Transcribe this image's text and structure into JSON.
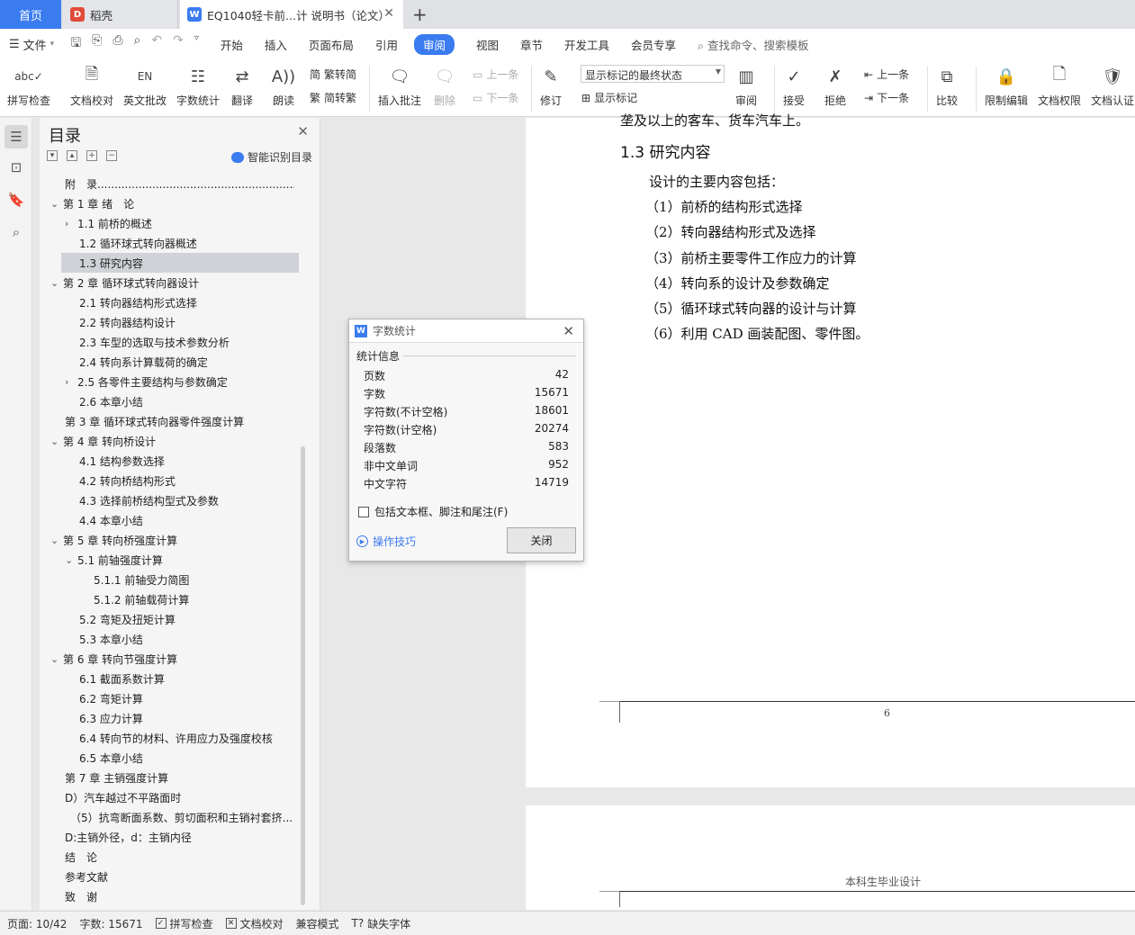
{
  "tabs": {
    "home": "首页",
    "t1": "稻壳",
    "t2": "EQ1040轻卡前...计 说明书（论文）",
    "new": "+"
  },
  "menu": {
    "file": "文件",
    "items": [
      "开始",
      "插入",
      "页面布局",
      "引用",
      "审阅",
      "视图",
      "章节",
      "开发工具",
      "会员专享"
    ],
    "active": "审阅",
    "search": "查找命令、搜索模板"
  },
  "ribbon": {
    "spell": "拼写检查",
    "proof": "文档校对",
    "english": "英文批改",
    "wordcount": "字数统计",
    "translate": "翻译",
    "read": "朗读",
    "trad": "繁转简",
    "simp": "简转繁",
    "comment": "插入批注",
    "delete": "删除",
    "prev_c": "上一条",
    "next_c": "下一条",
    "revise": "修订",
    "mark_state": "显示标记的最终状态",
    "show_mark": "显示标记",
    "review": "审阅",
    "accept": "接受",
    "reject": "拒绝",
    "prev": "上一条",
    "next": "下一条",
    "compare": "比较",
    "restrict": "限制编辑",
    "perm": "文档权限",
    "auth": "文档认证"
  },
  "toc": {
    "title": "目录",
    "smart": "智能识别目录",
    "items": [
      "附　录..........................................................................................",
      "第 1 章  绪　论",
      "1.1 前桥的概述",
      "1.2 循环球式转向器概述",
      "1.3 研究内容",
      "第 2 章  循环球式转向器设计",
      "2.1 转向器结构形式选择",
      "2.2 转向器结构设计",
      "2.3 车型的选取与技术参数分析",
      "2.4 转向系计算载荷的确定",
      "2.5 各零件主要结构与参数确定",
      "2.6 本章小结",
      "第 3 章  循环球式转向器零件强度计算",
      "第 4 章  转向桥设计",
      "4.1 结构参数选择",
      "4.2 转向桥结构形式",
      "4.3 选择前桥结构型式及参数",
      "4.4 本章小结",
      "第 5 章  转向桥强度计算",
      "5.1 前轴强度计算",
      "5.1.1 前轴受力简图",
      "5.1.2 前轴载荷计算",
      "5.2 弯矩及扭矩计算",
      "5.3 本章小结",
      "第 6 章  转向节强度计算",
      "6.1 截面系数计算",
      "6.2 弯矩计算",
      "6.3 应力计算",
      "6.4 转向节的材料、许用应力及强度校核",
      "6.5 本章小结",
      "第 7 章  主销强度计算",
      "D）汽车越过不平路面时",
      "（5）抗弯断面系数、剪切面积和主销衬套挤...",
      "D:主销外径，d：主销内径",
      "结　论",
      "参考文献",
      "致　谢"
    ]
  },
  "doc": {
    "cut_line": "垄及以上的客车、货车汽车上。",
    "heading": "1.3 研究内容",
    "intro": "设计的主要内容包括：",
    "items": [
      "（1）前桥的结构形式选择",
      "（2）转向器结构形式及选择",
      "（3）前桥主要零件工作应力的计算",
      "（4）转向系的设计及参数确定",
      "（5）循环球式转向器的设计与计算",
      "（6）利用 CAD 画装配图、零件图。"
    ],
    "page_num": "6",
    "header2": "本科生毕业设计"
  },
  "dialog": {
    "title": "字数统计",
    "section": "统计信息",
    "rows": [
      {
        "label": "页数",
        "value": "42"
      },
      {
        "label": "字数",
        "value": "15671"
      },
      {
        "label": "字符数(不计空格)",
        "value": "18601"
      },
      {
        "label": "字符数(计空格)",
        "value": "20274"
      },
      {
        "label": "段落数",
        "value": "583"
      },
      {
        "label": "非中文单词",
        "value": "952"
      },
      {
        "label": "中文字符",
        "value": "14719"
      }
    ],
    "checkbox": "包括文本框、脚注和尾注(F)",
    "tips": "操作技巧",
    "close": "关闭"
  },
  "status": {
    "page": "页面: 10/42",
    "words": "字数: 15671",
    "spell": "拼写检查",
    "proof": "文档校对",
    "compat": "兼容模式",
    "font": "缺失字体"
  },
  "colors": {
    "accent": "#3a7bef"
  }
}
